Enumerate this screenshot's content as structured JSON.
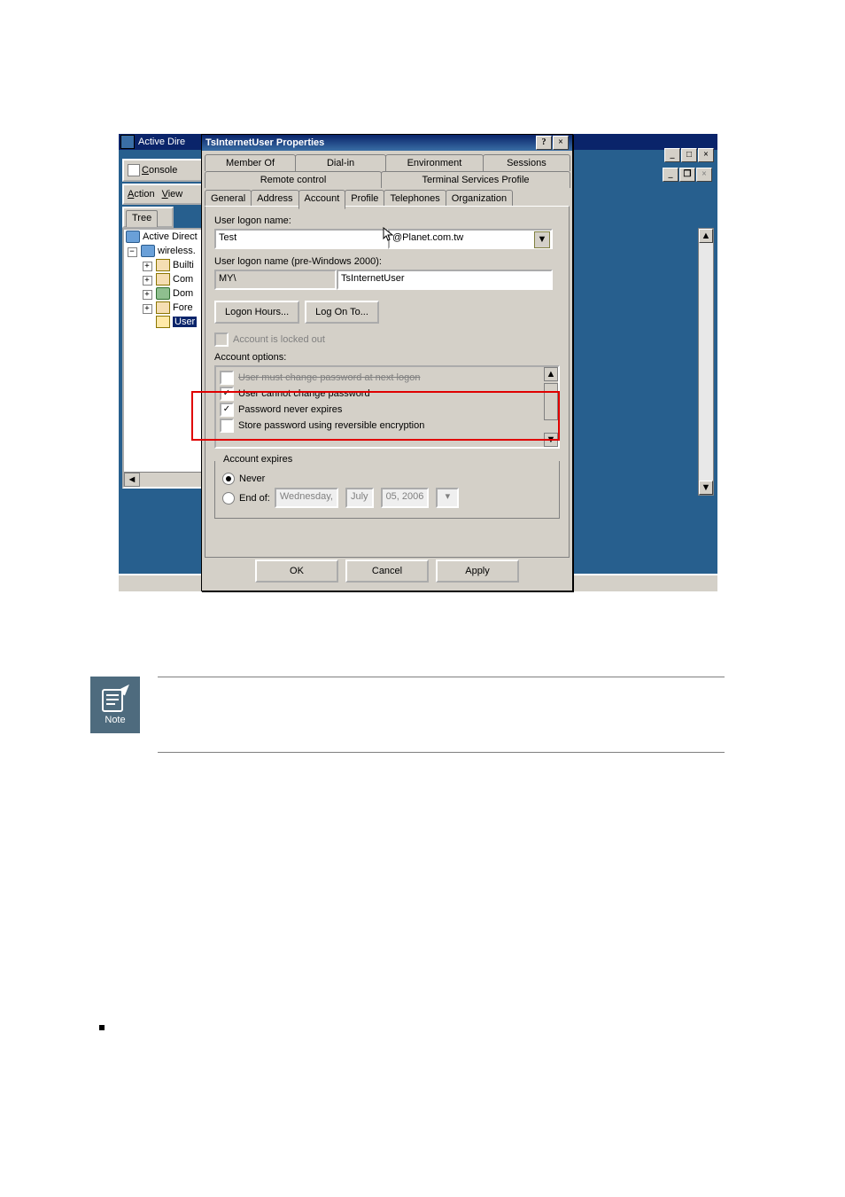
{
  "colors": {
    "accent": "#0a246a",
    "desktop": "#275f8e",
    "chrome": "#d4d0c8",
    "highlight_border": "#e00000"
  },
  "app": {
    "title": "Active Dire",
    "menu": {
      "console": "Console"
    },
    "toolbar": {
      "action": "Action",
      "view": "View"
    },
    "tree_tab": "Tree",
    "tree": {
      "root": "Active Direct",
      "domain": "wireless.",
      "items": [
        "Builti",
        "Com",
        "Dom",
        "Fore"
      ],
      "selected": "User"
    }
  },
  "dialog": {
    "title": "TsInternetUser Properties",
    "help_icon": "?",
    "tabs_row1": [
      "Member Of",
      "Dial-in",
      "Environment",
      "Sessions"
    ],
    "tabs_row2": [
      "Remote control",
      "Terminal Services Profile"
    ],
    "tabs_row3": [
      "General",
      "Address",
      "Account",
      "Profile",
      "Telephones",
      "Organization"
    ],
    "active_tab": "Account",
    "logon_label": "User logon name:",
    "logon_value": "Test",
    "domain_value": "@Planet.com.tw",
    "pre2000_label": "User logon name (pre-Windows 2000):",
    "pre2000_domain": "MY\\",
    "pre2000_user": "TsInternetUser",
    "btn_hours": "Logon Hours...",
    "btn_logonto": "Log On To...",
    "locked_label": "Account is locked out",
    "options_label": "Account options:",
    "options": [
      {
        "label": "User must change password at next logon",
        "checked": false,
        "strike": true
      },
      {
        "label": "User cannot change password",
        "checked": true
      },
      {
        "label": "Password never expires",
        "checked": true
      },
      {
        "label": "Store password using reversible encryption",
        "checked": false
      }
    ],
    "expires": {
      "legend": "Account expires",
      "never": "Never",
      "endof": "End of:",
      "date": {
        "weekday": "Wednesday,",
        "month": "July",
        "day_year": "05, 2006"
      }
    },
    "buttons": {
      "ok": "OK",
      "cancel": "Cancel",
      "apply": "Apply"
    }
  },
  "note": {
    "label": "Note"
  }
}
